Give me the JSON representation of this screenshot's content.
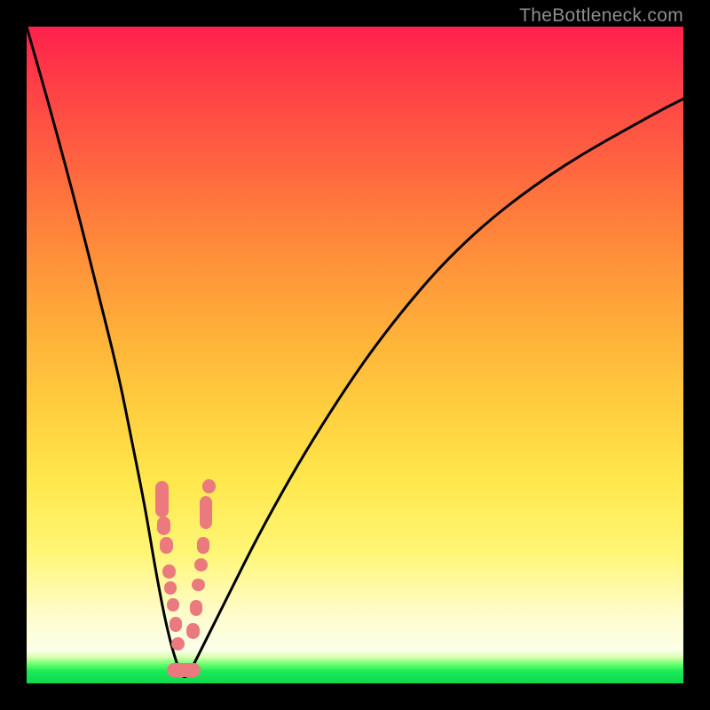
{
  "watermark_text": "TheBottleneck.com",
  "colors": {
    "curve_stroke": "#000000",
    "bead_fill": "#ea7a7d",
    "border": "#000000"
  },
  "chart_data": {
    "type": "line",
    "title": "",
    "xlabel": "",
    "ylabel": "",
    "xlim": [
      0,
      100
    ],
    "ylim": [
      0,
      100
    ],
    "annotations": [
      "TheBottleneck.com"
    ],
    "series": [
      {
        "name": "curve",
        "x": [
          0,
          4,
          8,
          11,
          14,
          16,
          18,
          19.5,
          21,
          22.5,
          24,
          26,
          30,
          36,
          44,
          54,
          66,
          80,
          96,
          100
        ],
        "y": [
          100,
          86,
          71,
          59,
          47,
          37,
          27,
          18,
          10,
          4,
          0,
          4,
          12,
          24,
          38,
          53,
          67,
          78,
          87,
          89
        ]
      }
    ],
    "beads_left": [
      {
        "x": 20.6,
        "y": 28.0,
        "w": 2.0,
        "h": 5.5
      },
      {
        "x": 20.9,
        "y": 24.0,
        "w": 2.0,
        "h": 2.8
      },
      {
        "x": 21.3,
        "y": 21.0,
        "w": 2.0,
        "h": 2.5
      },
      {
        "x": 21.7,
        "y": 17.0,
        "w": 2.0,
        "h": 2.2
      },
      {
        "x": 21.9,
        "y": 14.5,
        "w": 2.0,
        "h": 2.0
      },
      {
        "x": 22.3,
        "y": 12.0,
        "w": 2.0,
        "h": 2.0
      },
      {
        "x": 22.7,
        "y": 9.0,
        "w": 2.0,
        "h": 2.2
      },
      {
        "x": 23.0,
        "y": 6.0,
        "w": 2.0,
        "h": 2.0
      }
    ],
    "beads_right": [
      {
        "x": 27.8,
        "y": 30.0,
        "w": 2.0,
        "h": 2.2
      },
      {
        "x": 27.3,
        "y": 26.0,
        "w": 2.0,
        "h": 5.0
      },
      {
        "x": 26.9,
        "y": 21.0,
        "w": 2.0,
        "h": 2.5
      },
      {
        "x": 26.6,
        "y": 18.0,
        "w": 2.0,
        "h": 2.0
      },
      {
        "x": 26.2,
        "y": 15.0,
        "w": 2.0,
        "h": 2.0
      },
      {
        "x": 25.8,
        "y": 11.5,
        "w": 2.0,
        "h": 2.4
      },
      {
        "x": 25.3,
        "y": 8.0,
        "w": 2.0,
        "h": 2.4
      }
    ],
    "beads_bottom": [
      {
        "x": 23.2,
        "y": 2.0,
        "w": 3.8,
        "h": 2.2
      },
      {
        "x": 24.9,
        "y": 2.0,
        "w": 3.2,
        "h": 2.2
      }
    ]
  }
}
